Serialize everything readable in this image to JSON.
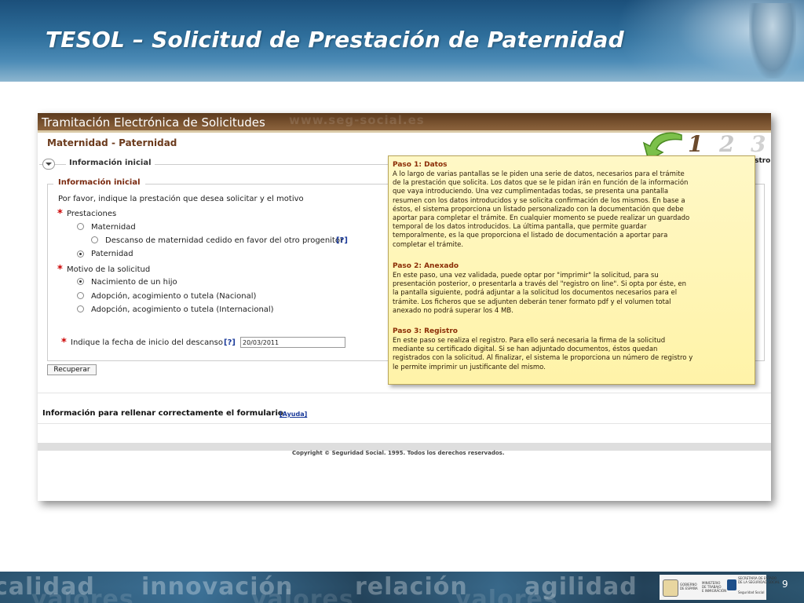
{
  "slide": {
    "title": "TESOL – Solicitud de Prestación de Paternidad",
    "page_number": "9"
  },
  "screenshot": {
    "banner_title": "Tramitación Electrónica de Solicitudes",
    "banner_watermark": "www.seg-social.es",
    "section_title": "Maternidad - Paternidad",
    "steps": [
      "1",
      "2",
      "3"
    ],
    "cut_text": "istro",
    "info_toggle_label": "Información inicial",
    "form": {
      "legend": "Información inicial",
      "intro": "Por favor, indique la prestación que desea solicitar y el motivo",
      "prestaciones_label": "Prestaciones",
      "prestaciones_options": [
        {
          "label": "Maternidad",
          "selected": false
        },
        {
          "label": "Descanso de maternidad cedido en favor del otro progenitor",
          "selected": false
        },
        {
          "label": "Paternidad",
          "selected": true
        }
      ],
      "motivo_label": "Motivo de la solicitud",
      "motivo_options": [
        {
          "label": "Nacimiento de un hijo",
          "selected": true
        },
        {
          "label": "Adopción, acogimiento o tutela (Nacional)",
          "selected": false
        },
        {
          "label": "Adopción, acogimiento o tutela (Internacional)",
          "selected": false
        }
      ],
      "help_label": "[?]",
      "fecha_label": "Indique la fecha de inicio del descanso",
      "fecha_value": "20/03/2011",
      "required_mark": "*"
    },
    "recuperar_label": "Recuperar",
    "info_rellenar": "Información para rellenar correctamente el formulario",
    "ayuda_label": "[Ayuda]",
    "copyright": "Copyright © Seguridad Social. 1995. Todos los derechos reservados."
  },
  "tooltip": {
    "steps": [
      {
        "title": "Paso 1: Datos",
        "lines": [
          "A lo largo de varias pantallas se le piden una serie de datos, necesarios para el trámite",
          "de la prestación que solicita. Los datos que se le pidan irán en función de la información",
          "que vaya introduciendo. Una vez cumplimentadas todas, se presenta una pantalla",
          "resumen con los datos introducidos y se solicita confirmación de los mismos. En base a",
          "éstos, el sistema proporciona un listado personalizado con la documentación que debe",
          "aportar para completar el trámite. En cualquier momento se puede realizar un guardado",
          "temporal de los datos introducidos. La última pantalla, que permite guardar",
          "temporalmente, es la que proporciona el listado de documentación a aportar para",
          "completar el trámite."
        ]
      },
      {
        "title": "Paso 2: Anexado",
        "lines": [
          "En este paso, una vez validada, puede optar por \"imprimir\" la solicitud, para su",
          "presentación posterior, o presentarla a través del \"registro on line\". Si opta por éste, en",
          "la pantalla siguiente, podrá adjuntar a la solicitud los documentos necesarios para el",
          "trámite. Los ficheros que se adjunten deberán tener formato pdf y el volumen total",
          "anexado no podrá superar los 4 MB."
        ]
      },
      {
        "title": "Paso 3: Registro",
        "lines": [
          "En este paso se realiza el registro. Para ello será necesaria la firma de la solicitud",
          "mediante su certificado digital. Si se han adjuntado documentos, éstos quedan",
          "registrados con la solicitud. Al finalizar, el sistema le proporciona un número de registro y",
          "le permite imprimir un justificante del mismo."
        ]
      }
    ]
  },
  "footer": {
    "words": [
      "calidad",
      "innovación",
      "relación",
      "agilidad"
    ],
    "words_low": [
      "valores",
      "valores",
      "valores"
    ],
    "logos": {
      "gobierno": [
        "GOBIERNO",
        "DE ESPAÑA"
      ],
      "ministerio": [
        "MINISTERIO",
        "DE TRABAJO",
        "E INMIGRACIÓN"
      ],
      "secretaria": [
        "SECRETARÍA DE ESTADO",
        "DE LA SEGURIDAD SOCIAL"
      ],
      "seguridad_social": [
        "Seguridad Social"
      ]
    }
  },
  "colors": {
    "header_blue": "#2f6f9c",
    "banner_brown": "#7a5330",
    "section_title": "#6b3a1c",
    "tooltip_bg": "#fff3a8",
    "tooltip_heading": "#8b2d06",
    "link": "#1a3a9a",
    "required": "#cc0000",
    "arrow_green": "#7cc04a"
  }
}
